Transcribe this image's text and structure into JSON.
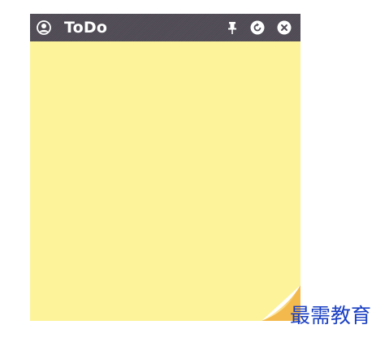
{
  "window": {
    "title": "ToDo"
  },
  "titlebar": {
    "icons": [
      "user-icon",
      "pin-icon",
      "refresh-icon",
      "close-icon"
    ]
  },
  "note": {
    "content": ""
  },
  "watermark": {
    "text": "最需教育"
  },
  "colors": {
    "titlebar": "#524d57",
    "note_background": "#fdf39a",
    "curl": "#f5c35a",
    "watermark": "#1a3fc2"
  }
}
